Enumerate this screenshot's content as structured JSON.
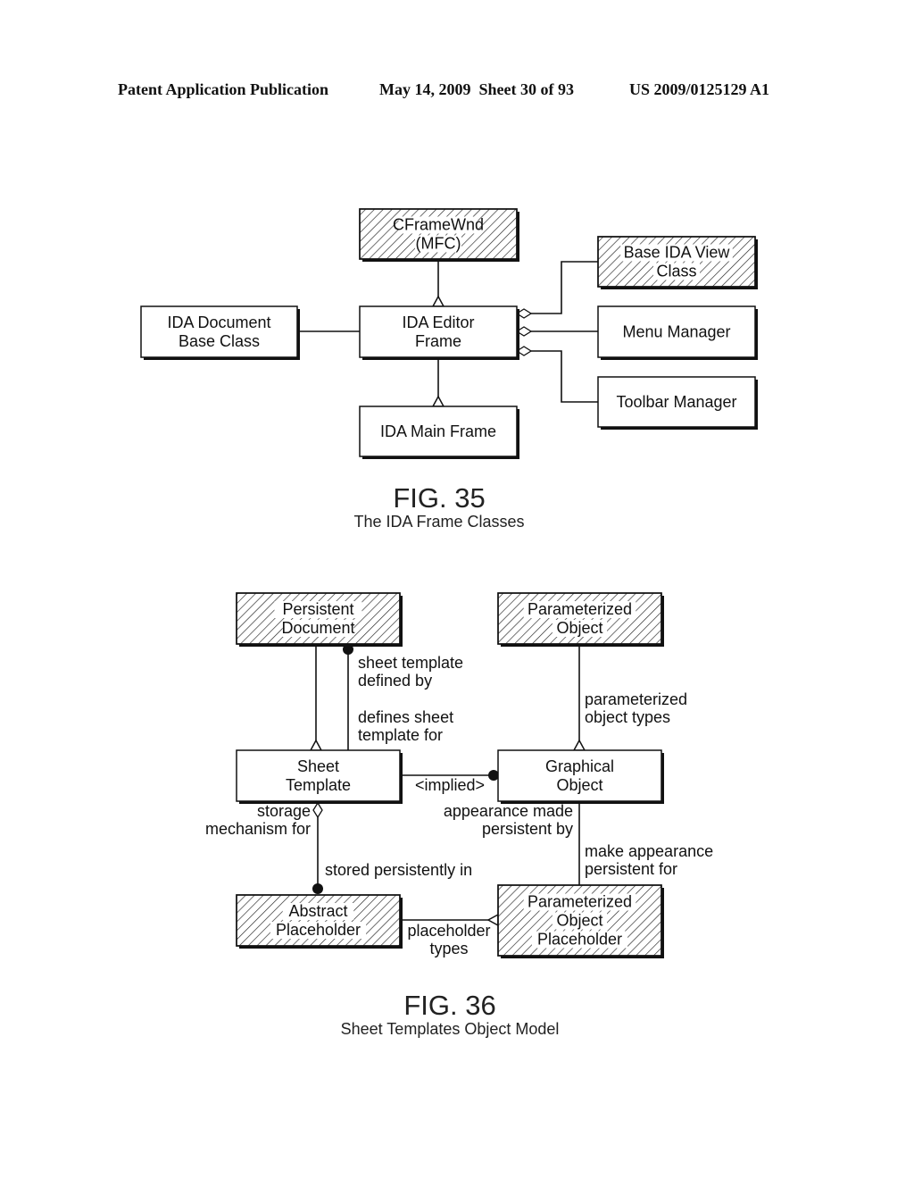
{
  "header": {
    "publication": "Patent Application Publication",
    "date_sheet": "May 14, 2009  Sheet 30 of 93",
    "patent_number": "US 2009/0125129 A1"
  },
  "fig35": {
    "title": "FIG. 35",
    "caption": "The IDA Frame Classes",
    "classes": {
      "cframewnd": [
        "CFrameWnd",
        "(MFC)"
      ],
      "base_view": [
        "Base IDA View",
        "Class"
      ],
      "doc_base": [
        "IDA Document",
        "Base Class"
      ],
      "editor_frame": [
        "IDA Editor",
        "Frame"
      ],
      "menu_manager": [
        "Menu Manager"
      ],
      "toolbar_manager": [
        "Toolbar Manager"
      ],
      "main_frame": [
        "IDA Main Frame"
      ]
    }
  },
  "fig36": {
    "title": "FIG. 36",
    "caption": "Sheet Templates Object Model",
    "classes": {
      "persistent_doc": [
        "Persistent",
        "Document"
      ],
      "param_object": [
        "Parameterized",
        "Object"
      ],
      "sheet_template": [
        "Sheet",
        "Template"
      ],
      "graphical_object": [
        "Graphical",
        "Object"
      ],
      "abstract_placeholder": [
        "Abstract",
        "Placeholder"
      ],
      "param_obj_placeholder": [
        "Parameterized",
        "Object",
        "Placeholder"
      ]
    },
    "labels": {
      "sheet_template_defined_by": [
        "sheet template",
        "defined by"
      ],
      "defines_sheet_template_for": [
        "defines sheet",
        "template for"
      ],
      "parameterized_object_types": [
        "parameterized",
        "object types"
      ],
      "implied": [
        "<implied>"
      ],
      "storage_mechanism_for": [
        "storage",
        "mechanism for"
      ],
      "appearance_made_persistent_by": [
        "appearance made",
        "persistent by"
      ],
      "make_appearance_persistent_for": [
        "make appearance",
        "persistent for"
      ],
      "stored_persistently_in": [
        "stored persistently in"
      ],
      "placeholder_types": [
        "placeholder",
        "types"
      ]
    }
  }
}
